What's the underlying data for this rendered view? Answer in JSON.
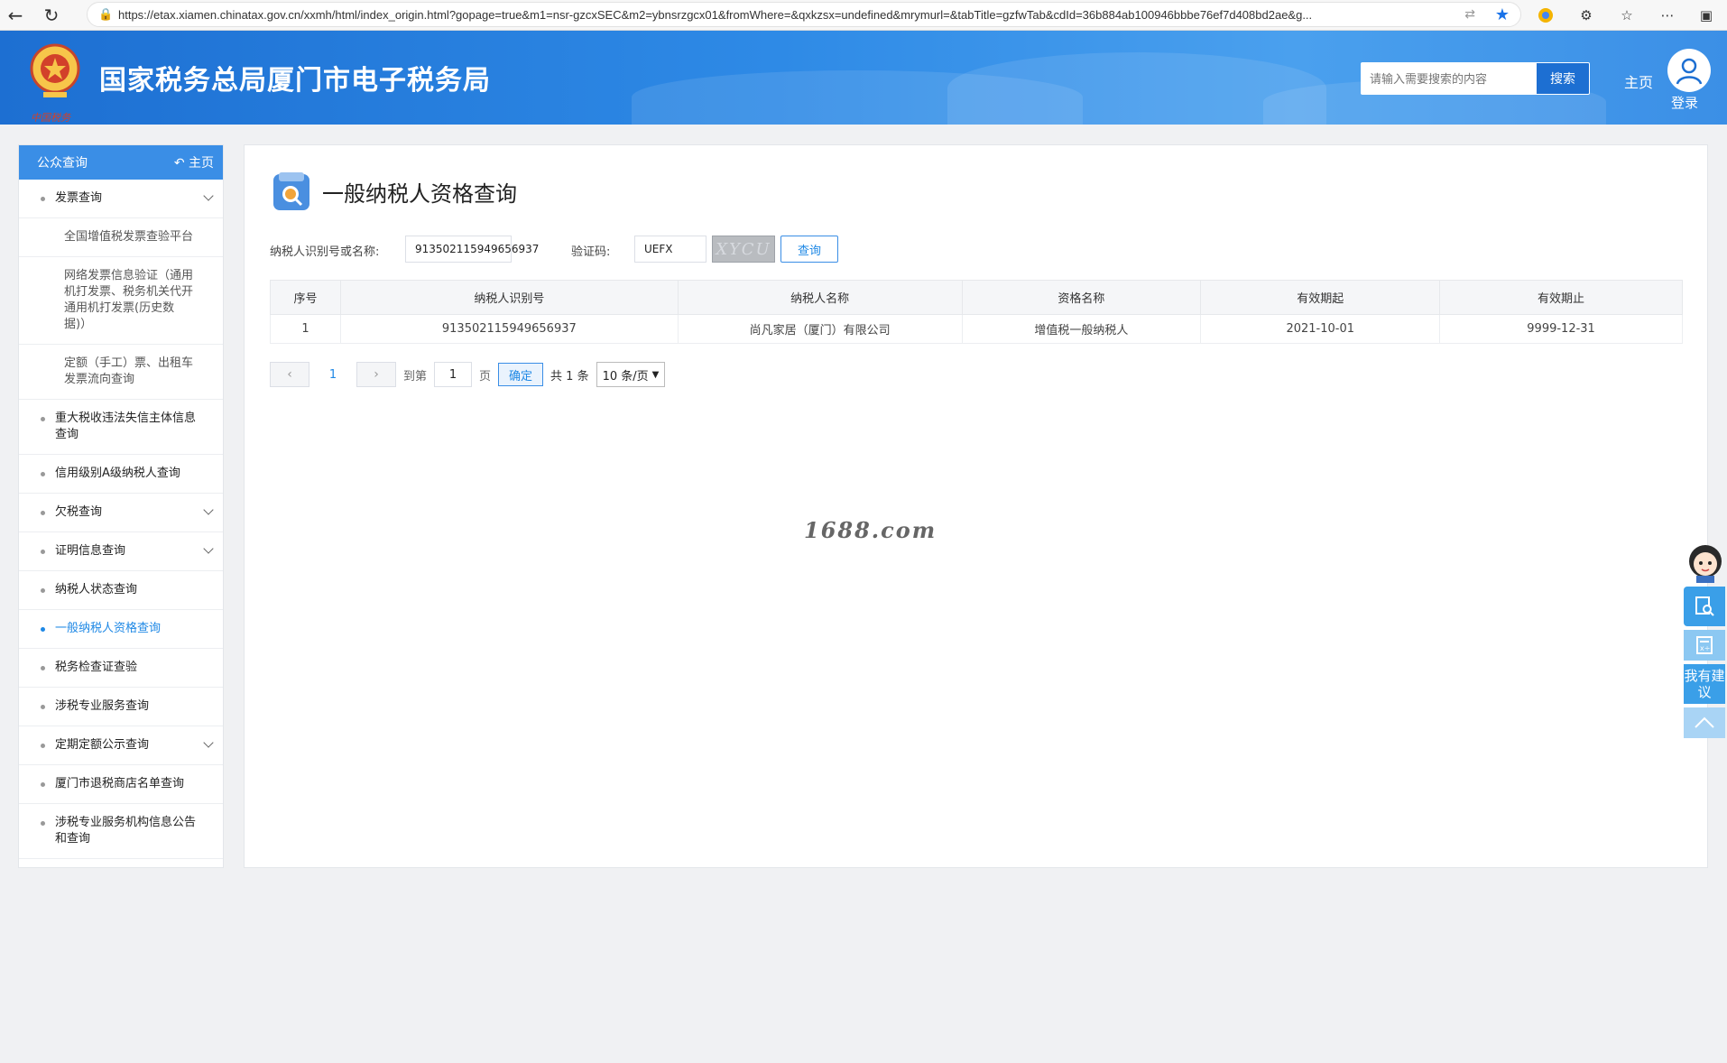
{
  "browser": {
    "url": "https://etax.xiamen.chinatax.gov.cn/xxmh/html/index_origin.html?gopage=true&m1=nsr-gzcxSEC&m2=ybnsrzgcx01&fromWhere=&qxkzsx=undefined&mrymurl=&tabTitle=gzfwTab&cdId=36b884ab100946bbbe76ef7d408bd2ae&g..."
  },
  "header": {
    "site_title": "国家税务总局厦门市电子税务局",
    "emblem_caption": "中国税务",
    "search_placeholder": "请输入需要搜索的内容",
    "search_button": "搜索",
    "home_link": "主页",
    "login_link": "登录"
  },
  "sidebar": {
    "title": "公众查询",
    "home_link": "主页",
    "items": [
      {
        "label": "发票查询"
      },
      {
        "label": "全国增值税发票查验平台"
      },
      {
        "label": "网络发票信息验证（通用机打发票、税务机关代开通用机打发票(历史数据)）"
      },
      {
        "label": "定额（手工）票、出租车发票流向查询"
      },
      {
        "label": "重大税收违法失信主体信息查询"
      },
      {
        "label": "信用级别A级纳税人查询"
      },
      {
        "label": "欠税查询"
      },
      {
        "label": "证明信息查询"
      },
      {
        "label": "纳税人状态查询"
      },
      {
        "label": "一般纳税人资格查询"
      },
      {
        "label": "税务检查证查验"
      },
      {
        "label": "涉税专业服务查询"
      },
      {
        "label": "定期定额公示查询"
      },
      {
        "label": "厦门市退税商店名单查询"
      },
      {
        "label": "涉税专业服务机构信息公告和查询"
      }
    ]
  },
  "main": {
    "title": "一般纳税人资格查询",
    "form": {
      "taxpayer_label": "纳税人识别号或名称:",
      "taxpayer_value": "913502115949656937",
      "captcha_label": "验证码:",
      "captcha_value": "UEFX",
      "captcha_image_text": "XYCU",
      "query_button": "查询"
    },
    "table": {
      "headers": [
        "序号",
        "纳税人识别号",
        "纳税人名称",
        "资格名称",
        "有效期起",
        "有效期止"
      ],
      "rows": [
        [
          "1",
          "913502115949656937",
          "尚凡家居（厦门）有限公司",
          "增值税一般纳税人",
          "2021-10-01",
          "9999-12-31"
        ]
      ]
    },
    "pager": {
      "current_page": "1",
      "goto_label": "到第",
      "goto_value": "1",
      "page_unit": "页",
      "confirm": "确定",
      "total": "共 1 条",
      "page_size": "10 条/页"
    },
    "watermark": "1688.com"
  },
  "float_toolbar": {
    "suggest": "我有建议"
  },
  "colors": {
    "accent": "#3a8ee6",
    "banner": "#1d6fd2"
  }
}
